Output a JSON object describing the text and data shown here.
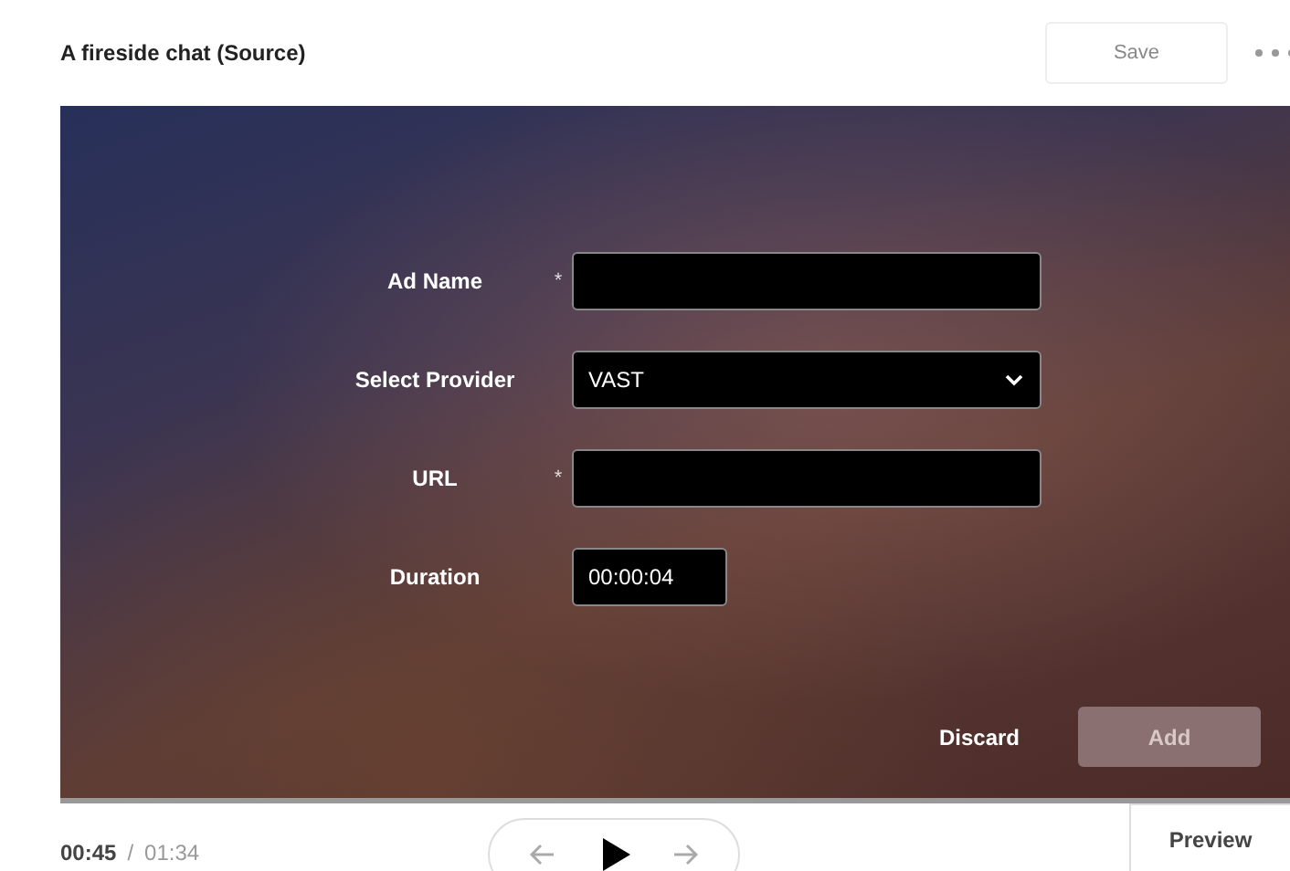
{
  "header": {
    "title": "A fireside chat (Source)",
    "save": {
      "label": "Save",
      "disabled": true
    }
  },
  "form": {
    "fields": [
      {
        "kind": "text",
        "label": "Ad Name",
        "required_mark": "*"
      },
      {
        "kind": "select",
        "label": "Select Provider",
        "value": "VAST"
      },
      {
        "kind": "text",
        "label": "URL",
        "required_mark": "*"
      },
      {
        "kind": "duration",
        "label": "Duration",
        "value": "00:00:04"
      }
    ],
    "discard": {
      "label": "Discard"
    },
    "add": {
      "label": "Add",
      "disabled": true
    }
  },
  "player": {
    "current": "00:45",
    "separator": "/",
    "total": "01:34",
    "preview": {
      "label": "Preview"
    }
  }
}
